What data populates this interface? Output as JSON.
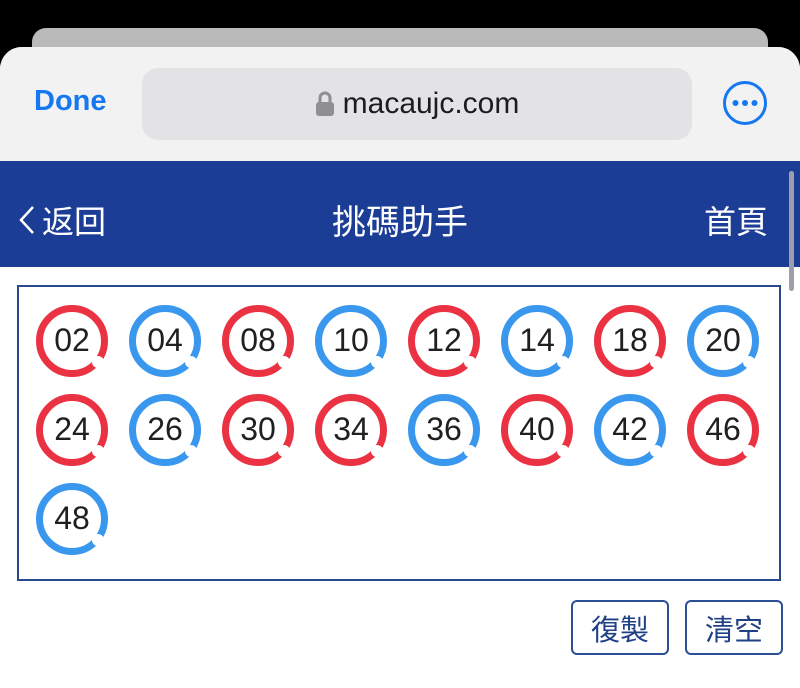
{
  "browser": {
    "done_label": "Done",
    "url": "macaujc.com"
  },
  "header": {
    "back_label": "返回",
    "title": "挑碼助手",
    "home_label": "首頁"
  },
  "balls": [
    {
      "number": "02",
      "color": "red"
    },
    {
      "number": "04",
      "color": "blue"
    },
    {
      "number": "08",
      "color": "red"
    },
    {
      "number": "10",
      "color": "blue"
    },
    {
      "number": "12",
      "color": "red"
    },
    {
      "number": "14",
      "color": "blue"
    },
    {
      "number": "18",
      "color": "red"
    },
    {
      "number": "20",
      "color": "blue"
    },
    {
      "number": "24",
      "color": "red"
    },
    {
      "number": "26",
      "color": "blue"
    },
    {
      "number": "30",
      "color": "red"
    },
    {
      "number": "34",
      "color": "red"
    },
    {
      "number": "36",
      "color": "blue"
    },
    {
      "number": "40",
      "color": "red"
    },
    {
      "number": "42",
      "color": "blue"
    },
    {
      "number": "46",
      "color": "red"
    },
    {
      "number": "48",
      "color": "blue"
    }
  ],
  "actions": {
    "copy_label": "復製",
    "clear_label": "清空"
  },
  "colors": {
    "red_ball": "#ea3243",
    "blue_ball": "#3a97ee",
    "header_bg": "#1c3d96",
    "link_blue": "#1578f0"
  }
}
